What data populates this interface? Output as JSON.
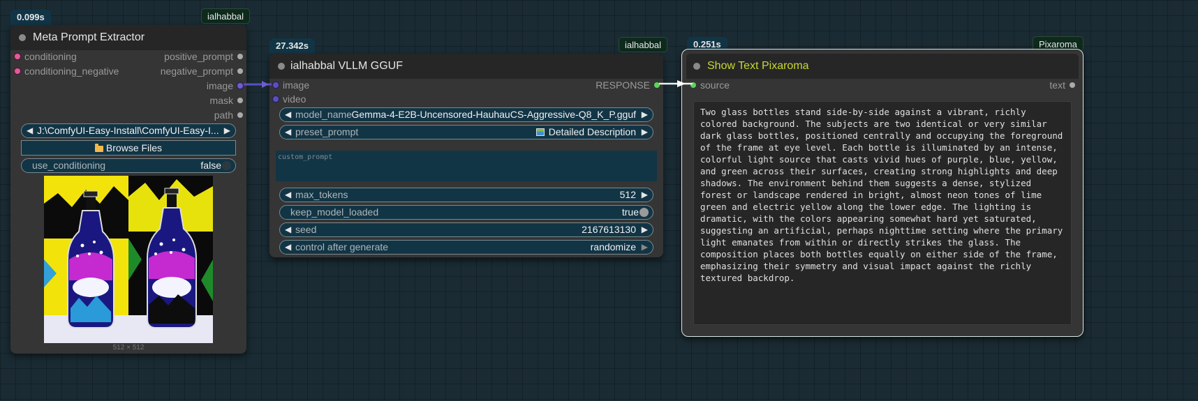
{
  "node1": {
    "time": "0.099s",
    "author": "ialhabbal",
    "title": "Meta Prompt Extractor",
    "inputs": [
      "conditioning",
      "conditioning_negative"
    ],
    "outputs": [
      "positive_prompt",
      "negative_prompt",
      "image",
      "mask",
      "path"
    ],
    "path_value": "J:\\ComfyUI-Easy-Install\\ComfyUI-Easy-I...",
    "browse_label": "Browse Files",
    "use_conditioning_label": "use_conditioning",
    "use_conditioning_value": "false",
    "image_size": "512 × 512"
  },
  "node2": {
    "time": "27.342s",
    "author": "ialhabbal",
    "title": "ialhabbal VLLM GGUF",
    "inputs": [
      "image",
      "video"
    ],
    "output": "RESPONSE",
    "model_name_label": "model_name",
    "model_name_value": "Gemma-4-E2B-Uncensored-HauhauCS-Aggressive-Q8_K_P.gguf",
    "preset_prompt_label": "preset_prompt",
    "preset_prompt_value": "Detailed Description",
    "custom_prompt_placeholder": "custom_prompt",
    "max_tokens_label": "max_tokens",
    "max_tokens_value": "512",
    "keep_model_loaded_label": "keep_model_loaded",
    "keep_model_loaded_value": "true",
    "seed_label": "seed",
    "seed_value": "2167613130",
    "control_label": "control after generate",
    "control_value": "randomize"
  },
  "node3": {
    "time": "0.251s",
    "author": "Pixaroma",
    "title": "Show Text Pixaroma",
    "input": "source",
    "output": "text",
    "text": "Two glass bottles stand side-by-side against a vibrant, richly colored background. The subjects are two identical or very similar dark glass bottles, positioned centrally and occupying the foreground of the frame at eye level. Each bottle is illuminated by an intense, colorful light source that casts vivid hues of purple, blue, yellow, and green across their surfaces, creating strong highlights and deep shadows. The environment behind them suggests a dense, stylized forest or landscape rendered in bright, almost neon tones of lime green and electric yellow along the lower edge. The lighting is dramatic, with the colors appearing somewhat hard yet saturated, suggesting an artificial, perhaps nighttime setting where the primary light emanates from within or directly strikes the glass. The composition places both bottles equally on either side of the frame, emphasizing their symmetry and visual impact against the richly textured backdrop."
  },
  "colors": {
    "canvas": "#1a2b33",
    "node_body": "#353535",
    "node_header": "#262626",
    "widget_bg": "#123546",
    "title_highlight": "#c8d92e",
    "selected_border": "#d9e8e4"
  }
}
